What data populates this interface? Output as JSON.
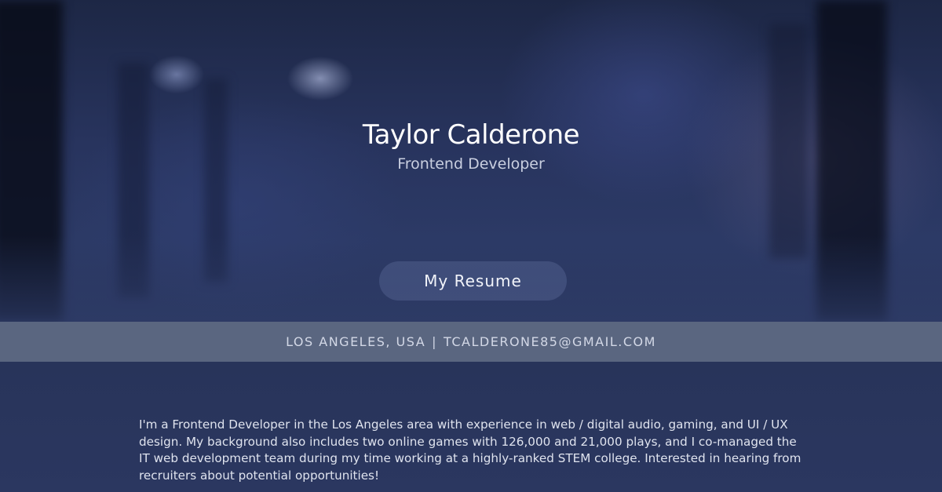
{
  "hero": {
    "name": "Taylor Calderone",
    "role": "Frontend Developer",
    "resume_button_label": "My Resume"
  },
  "contact": {
    "location": "LOS ANGELES, USA",
    "separator": "|",
    "email": "TCALDERONE85@GMAIL.COM"
  },
  "about": {
    "text": "I'm a Frontend Developer in the Los Angeles area with experience in web / digital audio, gaming, and UI / UX design. My background also includes two online games with 126,000 and 21,000 plays, and I co-managed the IT web development team during my time working at a highly-ranked STEM college. Interested in hearing from recruiters about potential opportunities!"
  },
  "colors": {
    "contact_bar": "#5a6680",
    "about_background": "#2a3556",
    "button_background": "#505f8c"
  }
}
